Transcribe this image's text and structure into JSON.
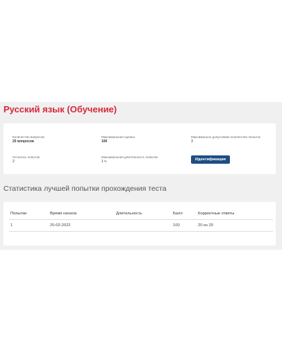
{
  "page": {
    "title": "Русский язык (Обучение)"
  },
  "info": {
    "questions_label": "Количество вопросов",
    "questions_value": "20 вопросов",
    "max_score_label": "Максимальная оценка",
    "max_score_value": "100",
    "max_attempts_label": "Максимально допустимое количество попыток",
    "max_attempts_value": "3",
    "attempts_left_label": "Осталось попыток",
    "attempts_left_value": "2",
    "max_duration_label": "Максимальная длительность попытки",
    "max_duration_value": "1 ч.",
    "identify_button": "Идентификация"
  },
  "stats": {
    "title": "Статистика лучшей попытки прохождения теста",
    "columns": [
      "Попытки",
      "Время начала",
      "Длительность",
      "Балл",
      "Корректные ответы"
    ],
    "rows": [
      [
        "1",
        "20-02-2022",
        "",
        "100",
        "20 из 20"
      ]
    ]
  },
  "colors": {
    "title": "#d62839",
    "button": "#1f4e82",
    "band": "#f0f0f0"
  }
}
